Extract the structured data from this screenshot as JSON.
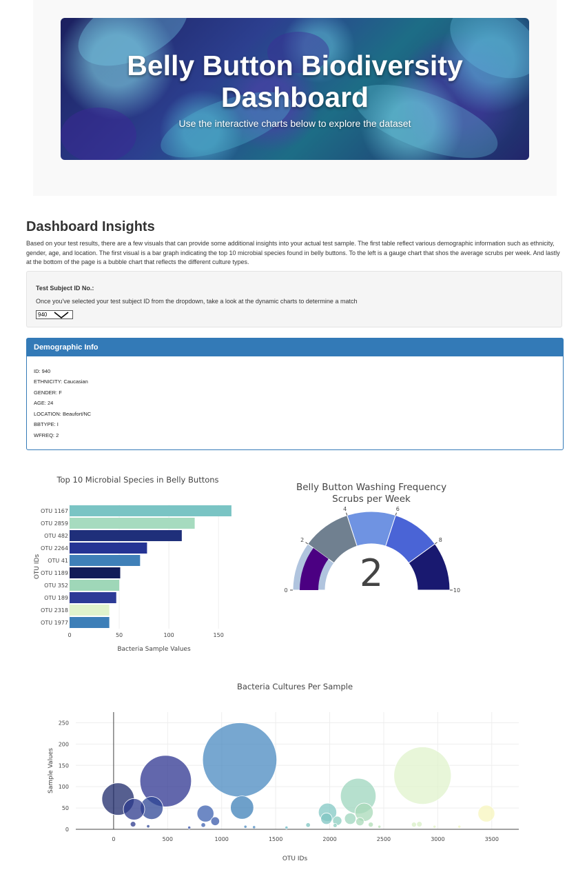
{
  "header": {
    "title_line1": "Belly Button Biodiversity",
    "title_line2": "Dashboard",
    "subtitle": "Use the interactive charts below to explore the dataset"
  },
  "insights": {
    "title": "Dashboard Insights",
    "text": "Based on your test results, there are a few visuals that can provide some additional insights into your actual test sample. The first table reflect various demographic information such as ethnicity, gender, age, and location. The first visual is a bar graph indicating the top 10 microbial species found in belly buttons. To the left is a gauge chart that shos the average scrubs per week. And lastly at the bottom of the page is a bubble chart that reflects the different culture types."
  },
  "selector": {
    "label": "Test Subject ID No.:",
    "help": "Once you've selected your test subject ID from the dropdown, take a look at the dynamic charts to determine a match",
    "selected": "940"
  },
  "demographic": {
    "heading": "Demographic Info",
    "lines": [
      "ID: 940",
      "ETHNICITY: Caucasian",
      "GENDER: F",
      "AGE: 24",
      "LOCATION: Beaufort/NC",
      "BBTYPE: I",
      "WFREQ: 2"
    ]
  },
  "chart_data": [
    {
      "type": "bar",
      "orientation": "horizontal",
      "title": "Top 10 Microbial Species in Belly Buttons",
      "xlabel": "Bacteria Sample Values",
      "ylabel": "OTU IDs",
      "categories": [
        "OTU 1167",
        "OTU 2859",
        "OTU 482",
        "OTU 2264",
        "OTU 41",
        "OTU 1189",
        "OTU 352",
        "OTU 189",
        "OTU 2318",
        "OTU 1977"
      ],
      "values": [
        163,
        126,
        113,
        78,
        71,
        51,
        50,
        47,
        40,
        40
      ],
      "colors": [
        "#7ac4c4",
        "#a6dbbf",
        "#1f2f7a",
        "#253494",
        "#3f80b8",
        "#121c58",
        "#9fd7b8",
        "#2c3a96",
        "#e0f3cc",
        "#3d7fb8"
      ],
      "xlim": [
        0,
        170
      ],
      "xticks": [
        0,
        50,
        100,
        150
      ],
      "grid": true
    },
    {
      "type": "gauge",
      "title": "Belly Button Washing Frequency",
      "subtitle": "Scrubs per Week",
      "value": 2,
      "range": [
        0,
        10
      ],
      "tick_labels": [
        "0",
        "2",
        "4",
        "6",
        "8",
        "10"
      ],
      "steps": [
        {
          "range": [
            0,
            2
          ],
          "color": "#b0c4de"
        },
        {
          "range": [
            2,
            4
          ],
          "color": "#708090"
        },
        {
          "range": [
            4,
            6
          ],
          "color": "#6f93e2"
        },
        {
          "range": [
            6,
            8
          ],
          "color": "#4a64d6"
        },
        {
          "range": [
            8,
            10
          ],
          "color": "#191970"
        }
      ],
      "bar_color": "#4b0082"
    },
    {
      "type": "scatter",
      "subtype": "bubble",
      "title": "Bacteria Cultures Per Sample",
      "xlabel": "OTU IDs",
      "ylabel": "Sample Values",
      "xlim": [
        -350,
        3750
      ],
      "ylim": [
        0,
        275
      ],
      "xticks": [
        0,
        500,
        1000,
        1500,
        2000,
        2500,
        3000,
        3500
      ],
      "yticks": [
        0,
        50,
        100,
        150,
        200,
        250
      ],
      "points": [
        {
          "x": 41,
          "y": 71,
          "c": "#1d2a6b"
        },
        {
          "x": 189,
          "y": 47,
          "c": "#2c3a8c"
        },
        {
          "x": 352,
          "y": 50,
          "c": "#2d4596"
        },
        {
          "x": 482,
          "y": 113,
          "c": "#2e3490"
        },
        {
          "x": 850,
          "y": 37,
          "c": "#3e62b0"
        },
        {
          "x": 940,
          "y": 19,
          "c": "#3a5aaa"
        },
        {
          "x": 1167,
          "y": 163,
          "c": "#4a8ac0"
        },
        {
          "x": 1189,
          "y": 51,
          "c": "#3d80b8"
        },
        {
          "x": 1980,
          "y": 40,
          "c": "#83c8c4"
        },
        {
          "x": 1970,
          "y": 25,
          "c": "#7ec4c2"
        },
        {
          "x": 2070,
          "y": 20,
          "c": "#8ccdc0"
        },
        {
          "x": 2190,
          "y": 25,
          "c": "#9dd5bd"
        },
        {
          "x": 2264,
          "y": 78,
          "c": "#9dd5bd"
        },
        {
          "x": 2318,
          "y": 40,
          "c": "#a8dab8"
        },
        {
          "x": 2280,
          "y": 18,
          "c": "#a8dab8"
        },
        {
          "x": 2859,
          "y": 126,
          "c": "#e0f3cc"
        },
        {
          "x": 3450,
          "y": 37,
          "c": "#f7f6bd"
        },
        {
          "x": 180,
          "y": 12,
          "c": "#2c3a8c"
        },
        {
          "x": 320,
          "y": 7,
          "c": "#2d4596"
        },
        {
          "x": 830,
          "y": 10,
          "c": "#3e62b0"
        },
        {
          "x": 1800,
          "y": 10,
          "c": "#7ec4c2"
        },
        {
          "x": 2050,
          "y": 9,
          "c": "#8ccdc0"
        },
        {
          "x": 2380,
          "y": 11,
          "c": "#b0ddb5"
        },
        {
          "x": 2780,
          "y": 11,
          "c": "#d8efc6"
        },
        {
          "x": 2830,
          "y": 12,
          "c": "#d8efc6"
        },
        {
          "x": 3200,
          "y": 6,
          "c": "#f0f5c0"
        },
        {
          "x": 1220,
          "y": 6,
          "c": "#4a8ac0"
        },
        {
          "x": 1300,
          "y": 5,
          "c": "#4a8ac0"
        },
        {
          "x": 700,
          "y": 4,
          "c": "#3550a8"
        },
        {
          "x": 2460,
          "y": 6,
          "c": "#b8e0b4"
        },
        {
          "x": 2970,
          "y": 6,
          "c": "#e3f3c6"
        },
        {
          "x": 1600,
          "y": 4,
          "c": "#6ab8c4"
        }
      ]
    }
  ]
}
